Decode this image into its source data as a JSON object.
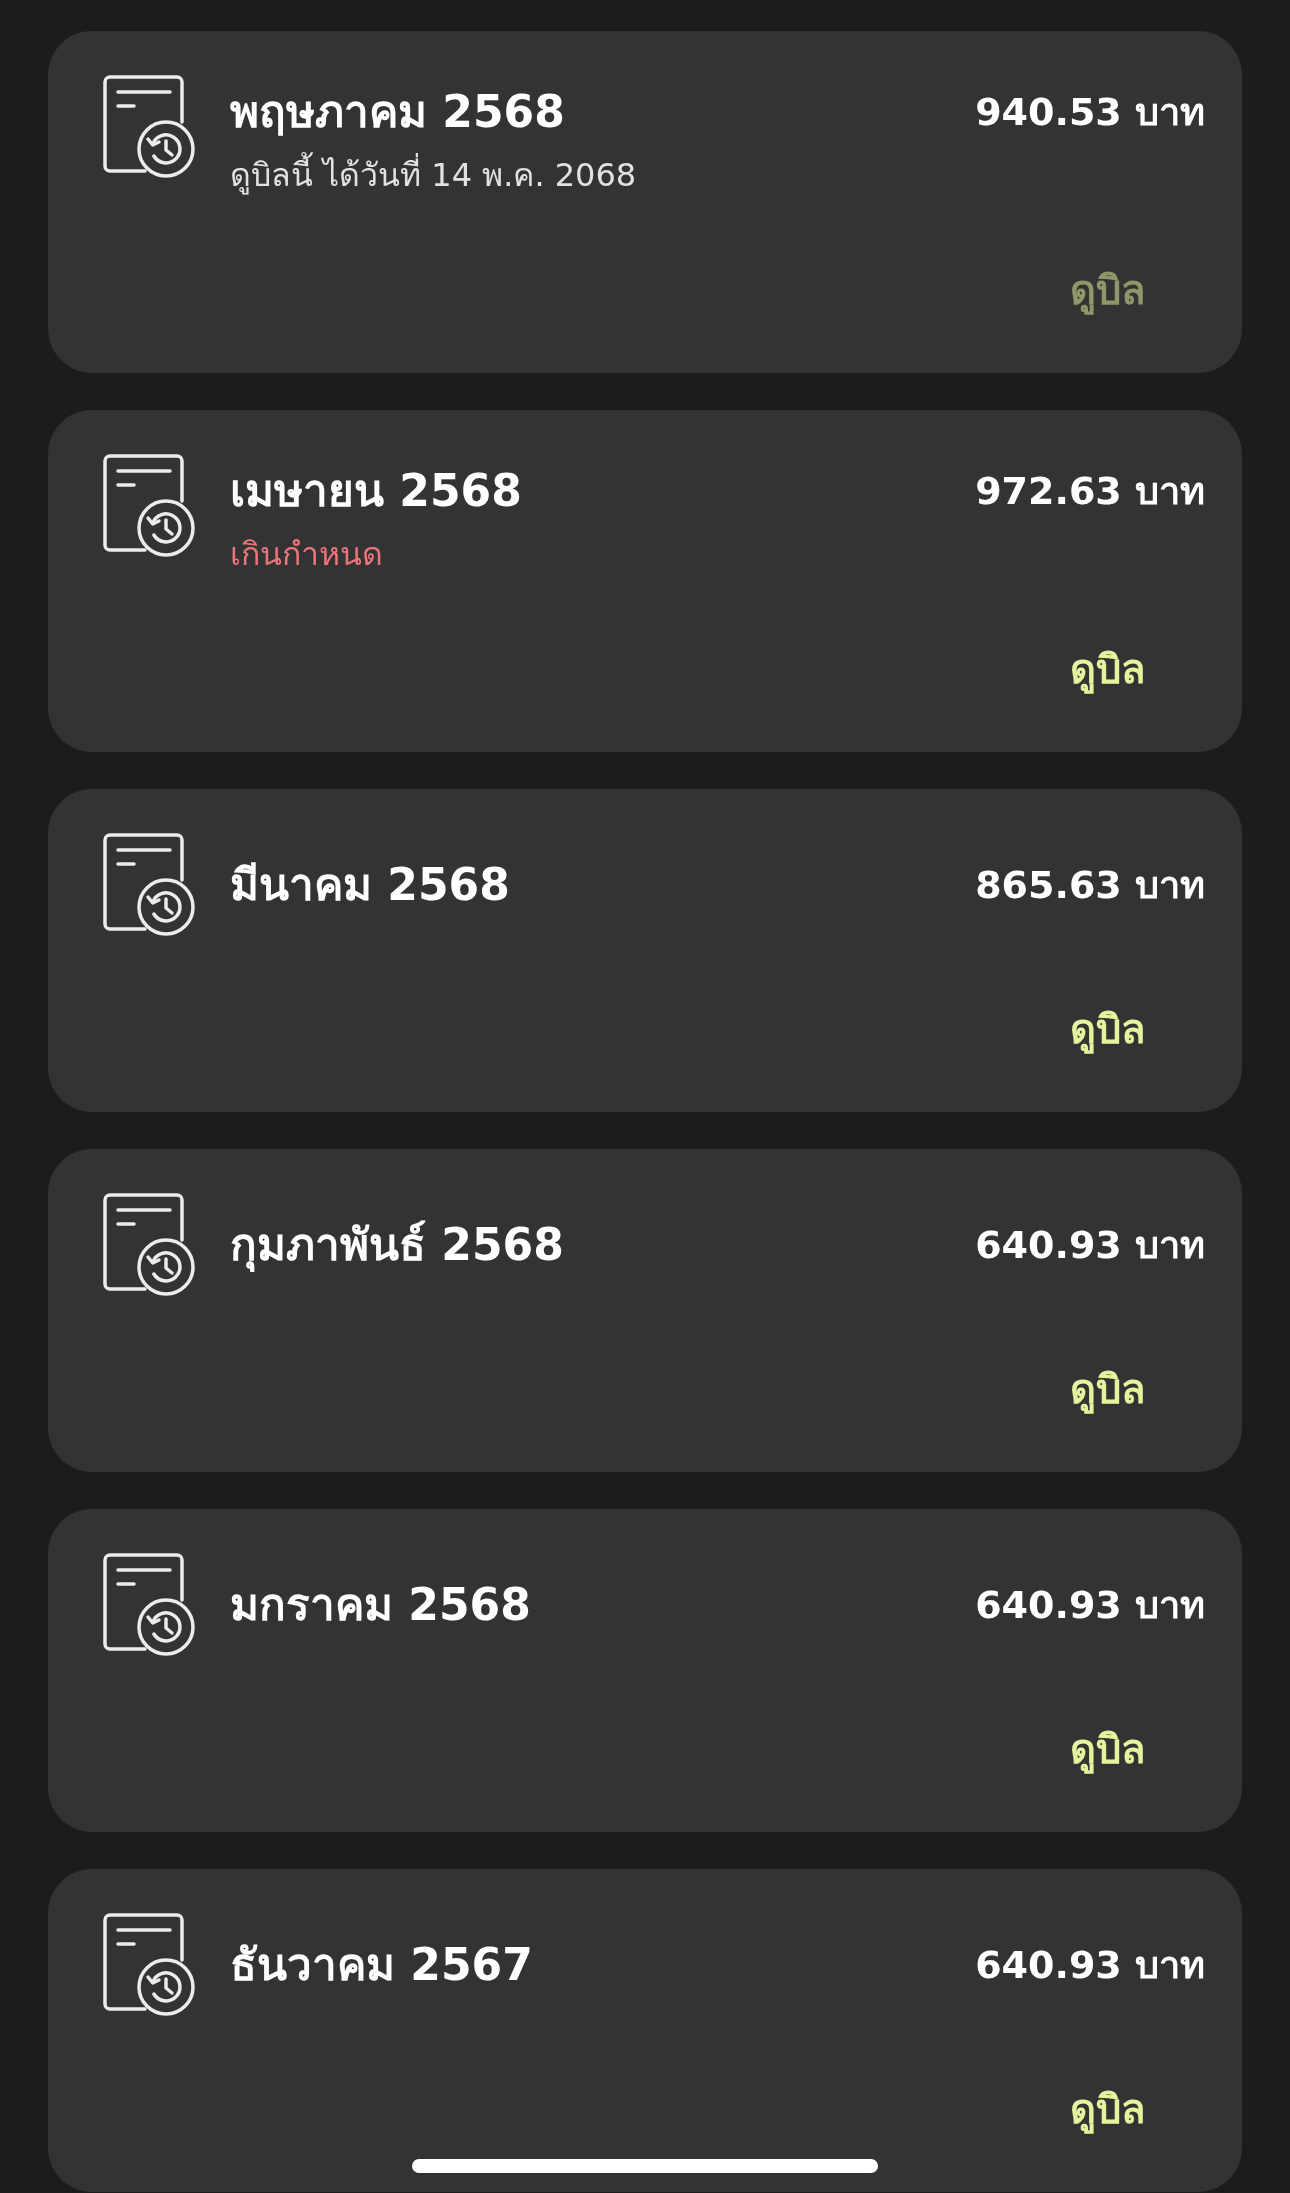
{
  "bills": [
    {
      "month": "พฤษภาคม 2568",
      "amount": "940.53 บาท",
      "note": {
        "kind": "info",
        "text": "ดูบิลนี้ ได้วันที่ 14 พ.ค. 2068"
      },
      "action": {
        "label": "ดูบิล",
        "disabled": true
      }
    },
    {
      "month": "เมษายน 2568",
      "amount": "972.63 บาท",
      "note": {
        "kind": "overdue",
        "text": "เกินกำหนด"
      },
      "action": {
        "label": "ดูบิล",
        "disabled": false
      }
    },
    {
      "month": "มีนาคม 2568",
      "amount": "865.63 บาท",
      "action": {
        "label": "ดูบิล",
        "disabled": false
      }
    },
    {
      "month": "กุมภาพันธ์ 2568",
      "amount": "640.93 บาท",
      "action": {
        "label": "ดูบิล",
        "disabled": false
      }
    },
    {
      "month": "มกราคม 2568",
      "amount": "640.93 บาท",
      "action": {
        "label": "ดูบิล",
        "disabled": false
      }
    },
    {
      "month": "ธันวาคม 2567",
      "amount": "640.93 บาท",
      "action": {
        "label": "ดูบิล",
        "disabled": false
      }
    }
  ]
}
